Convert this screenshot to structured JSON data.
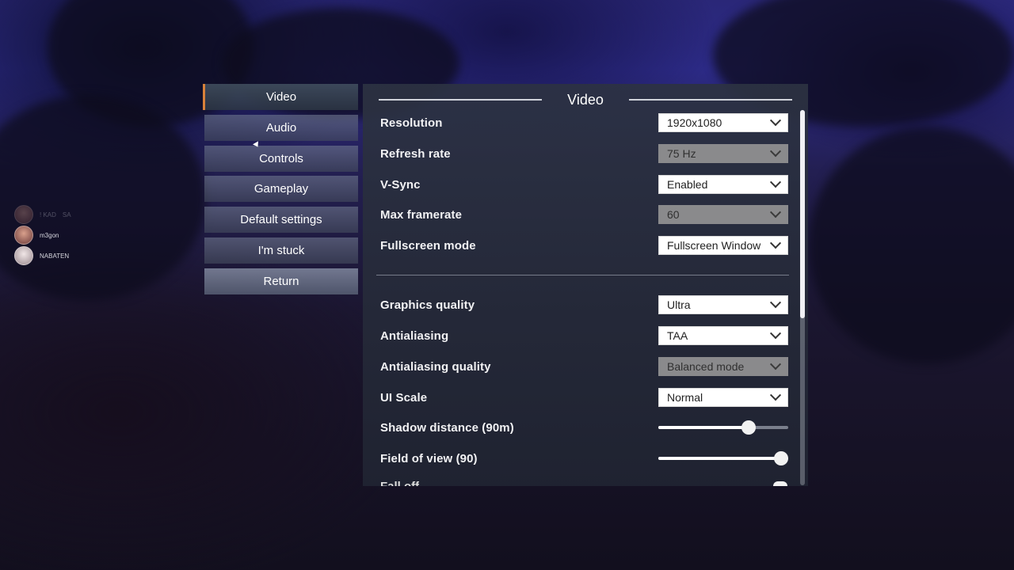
{
  "menu": {
    "items": [
      {
        "label": "Video",
        "active": true
      },
      {
        "label": "Audio",
        "active": false
      },
      {
        "label": "Controls",
        "active": false
      },
      {
        "label": "Gameplay",
        "active": false
      },
      {
        "label": "Default settings",
        "active": false
      },
      {
        "label": "I'm stuck",
        "active": false
      }
    ],
    "return_label": "Return"
  },
  "players": [
    {
      "name": "! KAD",
      "tag": "SA"
    },
    {
      "name": "m3gon"
    },
    {
      "name": "NABATEN"
    }
  ],
  "panel": {
    "title": "Video",
    "display": [
      {
        "label": "Resolution",
        "value": "1920x1080",
        "enabled": true
      },
      {
        "label": "Refresh rate",
        "value": "75 Hz",
        "enabled": false
      },
      {
        "label": "V-Sync",
        "value": "Enabled",
        "enabled": true
      },
      {
        "label": "Max framerate",
        "value": "60",
        "enabled": false
      },
      {
        "label": "Fullscreen mode",
        "value": "Fullscreen Window",
        "enabled": true
      }
    ],
    "graphics": [
      {
        "label": "Graphics quality",
        "value": "Ultra",
        "enabled": true
      },
      {
        "label": "Antialiasing",
        "value": "TAA",
        "enabled": true
      },
      {
        "label": "Antialiasing quality",
        "value": "Balanced mode",
        "enabled": false
      },
      {
        "label": "UI Scale",
        "value": "Normal",
        "enabled": true
      }
    ],
    "sliders": [
      {
        "label": "Shadow distance (90m)",
        "level": 0.72
      },
      {
        "label": "Field of view (90)",
        "level": 1.0
      }
    ],
    "cut_label": "Fall off"
  },
  "colors": {
    "accent": "#d8813a",
    "panel_bg": "#2c3244",
    "select_disabled": "#8a8a8c"
  },
  "icons": {
    "dropdown": "chevron-down-icon",
    "cursor": "mouse-cursor-icon"
  }
}
